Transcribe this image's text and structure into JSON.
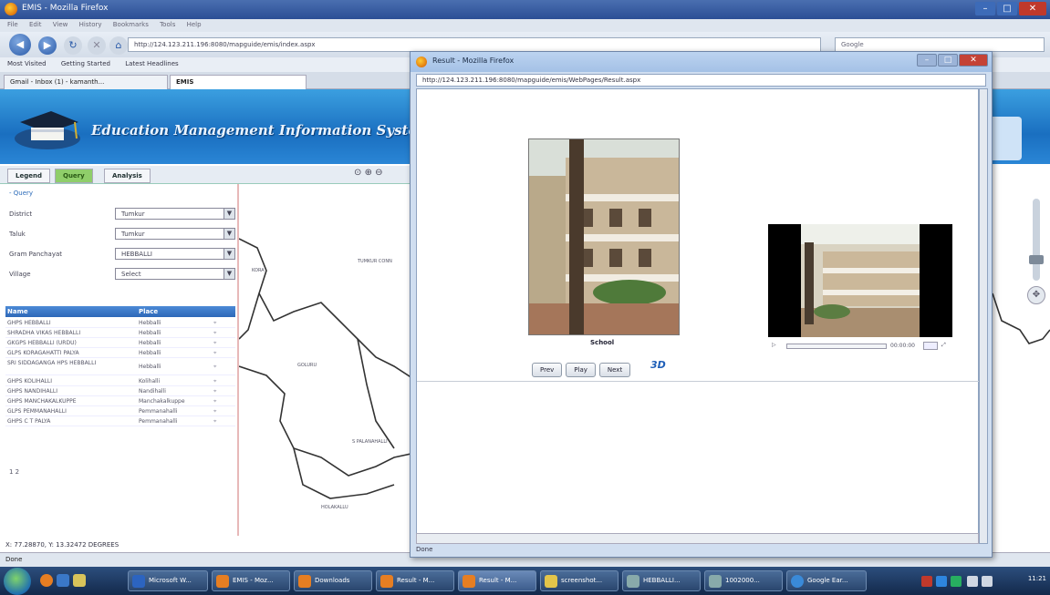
{
  "browser": {
    "window_title": "EMIS - Mozilla Firefox",
    "menu": [
      "File",
      "Edit",
      "View",
      "History",
      "Bookmarks",
      "Tools",
      "Help"
    ],
    "url": "http://124.123.211.196:8080/mapguide/emis/index.aspx",
    "search_placeholder": "Google",
    "bookmarks": [
      "Most Visited",
      "Getting Started",
      "Latest Headlines"
    ],
    "tabs": [
      "Gmail - Inbox (1) - kamanth...",
      "EMIS"
    ],
    "status": "Done"
  },
  "app": {
    "title": "Education Management Information System",
    "tabs": [
      "Legend",
      "Query",
      "Analysis"
    ],
    "active_tab": "Query",
    "query": {
      "header": "Query",
      "fields": [
        {
          "label": "District",
          "value": "Tumkur"
        },
        {
          "label": "Taluk",
          "value": "Tumkur"
        },
        {
          "label": "Gram Panchayat",
          "value": "HEBBALLI"
        },
        {
          "label": "Village",
          "value": "Select"
        }
      ]
    },
    "results": {
      "col_name": "Name",
      "col_place": "Place",
      "rows": [
        {
          "name": "GHPS HEBBALLI",
          "place": "Hebballi"
        },
        {
          "name": "SHRADHA VIKAS HEBBALLI",
          "place": "Hebballi"
        },
        {
          "name": "GKGPS HEBBALLI (URDU)",
          "place": "Hebballi"
        },
        {
          "name": "GLPS KORAGAHATTI PALYA",
          "place": "Hebballi"
        },
        {
          "name": "SRI SIDDAGANGA HPS HEBBALLI",
          "place": "Hebballi"
        },
        {
          "name": "GHPS KOLIHALLI",
          "place": "Kolihalli"
        },
        {
          "name": "GHPS NANDIHALLI",
          "place": "Nandihalli"
        },
        {
          "name": "GHPS MANCHAKALKUPPE",
          "place": "Manchakalkuppe"
        },
        {
          "name": "GLPS PEMMANAHALLI",
          "place": "Pemmanahalli"
        },
        {
          "name": "GHPS C T PALYA",
          "place": "Pemmanahalli"
        }
      ],
      "pager": "1 2"
    },
    "map_labels": [
      "KORA",
      "GOLURU",
      "S PALANAHALLI",
      "HOLAKALLU",
      "TUMKUR CONN"
    ],
    "coords": "X: 77.28870, Y: 13.32472 DEGREES"
  },
  "popup": {
    "title": "Result - Mozilla Firefox",
    "url": "http://124.123.211.196:8080/mapguide/emis/WebPages/Result.aspx",
    "photo_caption": "School",
    "buttons": [
      "Prev",
      "Play",
      "Next"
    ],
    "icon_3d": "3D",
    "video_time": "00:00:00",
    "status": "Done"
  },
  "taskbar": {
    "items": [
      "Microsoft W...",
      "EMIS - Moz...",
      "Downloads",
      "Result - M...",
      "Result - M...",
      "screenshot...",
      "HEBBALLI...",
      "1002000...",
      "Google Ear..."
    ],
    "clock": "11:21"
  },
  "colors": {
    "banner": "#1a6fc0",
    "active_tab": "#8fce6a",
    "results_header": "#2d68b8",
    "map_border": "#e7b8b8"
  }
}
